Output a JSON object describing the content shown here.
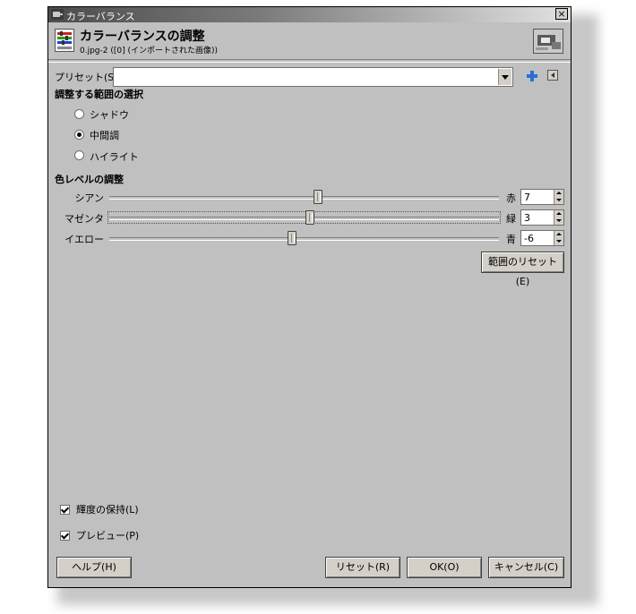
{
  "window": {
    "title": "カラーバランス",
    "close_glyph": "×"
  },
  "header": {
    "title": "カラーバランスの調整",
    "subtitle": "0.jpg-2 ([0] (インポートされた画像))"
  },
  "preset": {
    "label": "プリセット(S):",
    "value": ""
  },
  "range": {
    "heading": "調整する範囲の選択",
    "options": [
      {
        "label": "シャドウ",
        "selected": false
      },
      {
        "label": "中間調",
        "selected": true
      },
      {
        "label": "ハイライト",
        "selected": false
      }
    ]
  },
  "color_levels": {
    "heading": "色レベルの調整",
    "rows": [
      {
        "left_label": "シアン",
        "right_label": "赤",
        "value": "7",
        "numeric": 7
      },
      {
        "left_label": "マゼンタ",
        "right_label": "緑",
        "value": "3",
        "numeric": 3
      },
      {
        "left_label": "イエロー",
        "right_label": "青",
        "value": "-6",
        "numeric": -6
      }
    ],
    "range_min": -100,
    "range_max": 100,
    "reset_range_label": "範囲のリセット(E)"
  },
  "options": {
    "preserve_luminosity": {
      "label": "輝度の保持(L)",
      "checked": true
    },
    "preview": {
      "label": "プレビュー(P)",
      "checked": true
    }
  },
  "buttons": {
    "help": "ヘルプ(H)",
    "reset": "リセット(R)",
    "ok": "OK(O)",
    "cancel": "キャンセル(C)"
  }
}
